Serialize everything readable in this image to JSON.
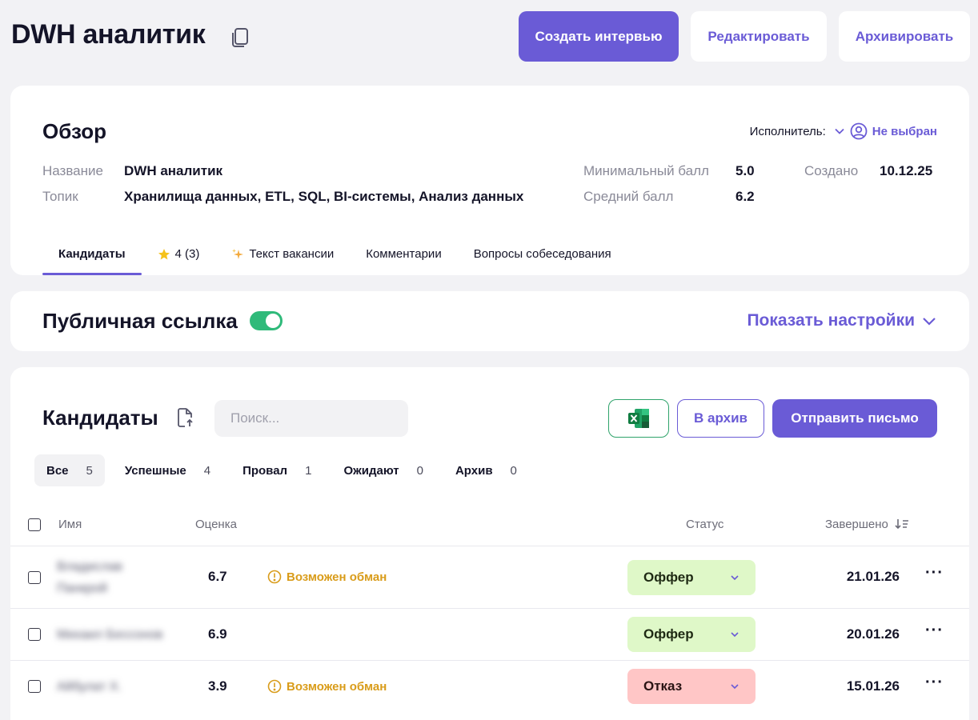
{
  "header": {
    "title": "DWH аналитик",
    "create_interview": "Создать интервью",
    "edit": "Редактировать",
    "archive": "Архивировать"
  },
  "overview": {
    "title": "Обзор",
    "assignee_label": "Исполнитель:",
    "assignee_value": "Не выбран",
    "name_label": "Название",
    "name_value": "DWH аналитик",
    "topic_label": "Топик",
    "topic_value": "Хранилища данных, ETL, SQL, BI-системы, Анализ данных",
    "min_score_label": "Минимальный балл",
    "min_score_value": "5.0",
    "avg_score_label": "Средний балл",
    "avg_score_value": "6.2",
    "created_label": "Создано",
    "created_value": "10.12.25",
    "tabs": [
      {
        "label": "Кандидаты",
        "active": true
      },
      {
        "label": "4 (3)",
        "icon": "star-icon"
      },
      {
        "label": "Текст вакансии",
        "icon": "sparkles-icon"
      },
      {
        "label": "Комментарии"
      },
      {
        "label": "Вопросы собеседования"
      }
    ]
  },
  "public_link": {
    "title": "Публичная ссылка",
    "enabled": true,
    "show_settings": "Показать настройки"
  },
  "candidates": {
    "title": "Кандидаты",
    "search_placeholder": "Поиск...",
    "to_archive": "В архив",
    "send_letter": "Отправить письмо",
    "filters": [
      {
        "label": "Все",
        "count": "5",
        "active": true
      },
      {
        "label": "Успешные",
        "count": "4"
      },
      {
        "label": "Провал",
        "count": "1"
      },
      {
        "label": "Ожидают",
        "count": "0"
      },
      {
        "label": "Архив",
        "count": "0"
      }
    ],
    "columns": {
      "name": "Имя",
      "score": "Оценка",
      "status": "Статус",
      "completed": "Завершено"
    },
    "rows": [
      {
        "name": "Владислав Панкрой",
        "score": "6.7",
        "warning": "Возможен обман",
        "status": "Оффер",
        "date": "21.01.26"
      },
      {
        "name": "Михаил Бессонов",
        "score": "6.9",
        "warning": "",
        "status": "Оффер",
        "date": "20.01.26"
      },
      {
        "name": "Айбулат Х.",
        "score": "3.9",
        "warning": "Возможен обман",
        "status": "Отказ",
        "date": "15.01.26"
      }
    ]
  },
  "colors": {
    "accent": "#6a5bd6",
    "toggle_on": "#2fba7a",
    "offer_bg": "#dff8c8",
    "reject_bg": "#ffc6c6",
    "warning": "#d99c1a"
  }
}
